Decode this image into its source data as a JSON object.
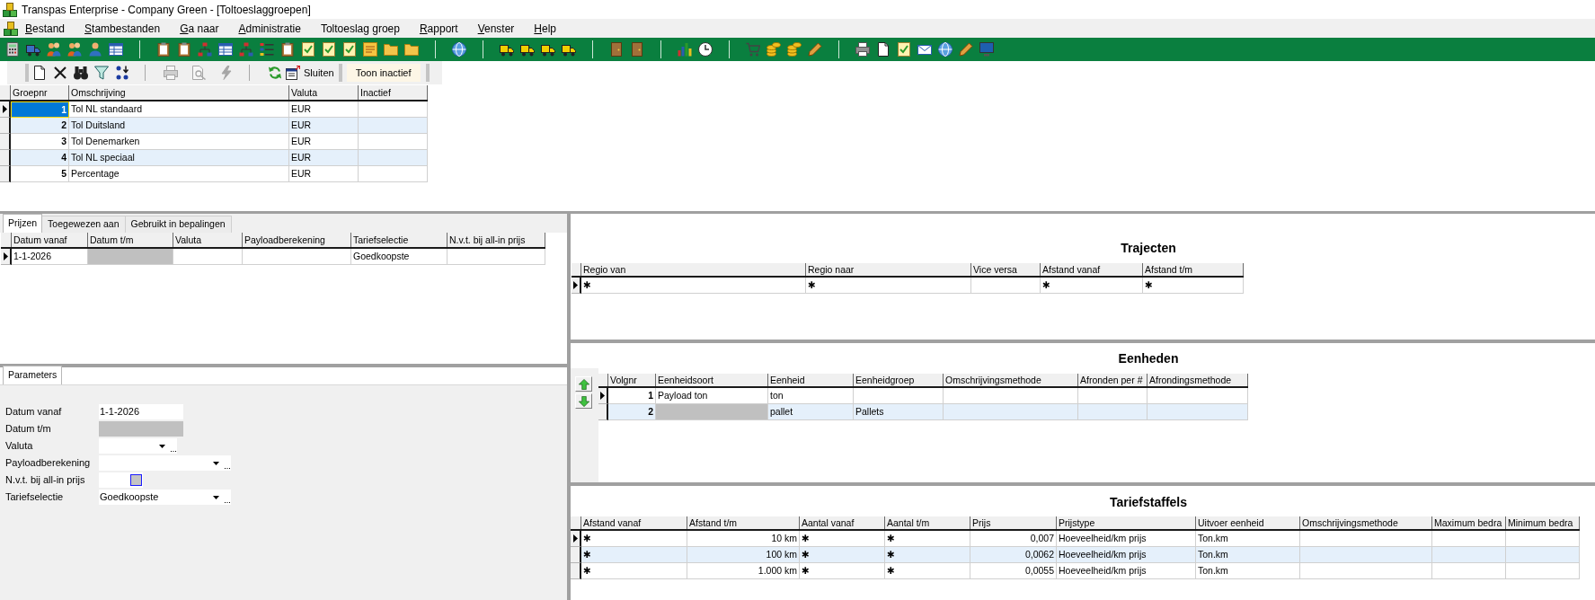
{
  "window": {
    "title": "Transpas Enterprise - Company Green - [Toltoeslaggroepen]"
  },
  "menu": [
    {
      "label": "Bestand",
      "mnemonic": true
    },
    {
      "label": "Stambestanden",
      "mnemonic": true
    },
    {
      "label": "Ga naar",
      "mnemonic": true
    },
    {
      "label": "Administratie",
      "mnemonic": true
    },
    {
      "label": "Toltoeslag groep",
      "mnemonic": false
    },
    {
      "label": "Rapport",
      "mnemonic": true
    },
    {
      "label": "Venster",
      "mnemonic": true
    },
    {
      "label": "Help",
      "mnemonic": true
    }
  ],
  "record_toolbar": {
    "tools": [
      {
        "disabled": false
      },
      {
        "disabled": false
      },
      {
        "disabled": false
      },
      {
        "disabled": false
      },
      {
        "disabled": false
      },
      {
        "disabled": true
      },
      {
        "disabled": true
      },
      {
        "disabled": true
      },
      {
        "disabled": false
      }
    ],
    "close_label": "Sluiten",
    "toggle_label": "Toon inactief"
  },
  "groups_table": {
    "columns": [
      "Groepnr",
      "Omschrijving",
      "Valuta",
      "Inactief"
    ],
    "rows": [
      {
        "selected": true,
        "cells": [
          {
            "text": "1",
            "focused": true
          },
          {
            "text": "Tol NL standaard",
            "focused": false
          },
          {
            "text": "EUR",
            "focused": false
          },
          {
            "focused": false
          }
        ]
      },
      {
        "selected": false,
        "cells": [
          {
            "text": "2",
            "focused": false
          },
          {
            "text": "Tol Duitsland",
            "focused": false
          },
          {
            "text": "EUR",
            "focused": false
          },
          {
            "focused": false
          }
        ]
      },
      {
        "selected": false,
        "cells": [
          {
            "text": "3",
            "focused": false
          },
          {
            "text": "Tol Denemarken",
            "focused": false
          },
          {
            "text": "EUR",
            "focused": false
          },
          {
            "focused": false
          }
        ]
      },
      {
        "selected": false,
        "cells": [
          {
            "text": "4",
            "focused": false
          },
          {
            "text": "Tol NL speciaal",
            "focused": false
          },
          {
            "text": "EUR",
            "focused": false
          },
          {
            "focused": false
          }
        ]
      },
      {
        "selected": false,
        "cells": [
          {
            "text": "5",
            "focused": false
          },
          {
            "text": "Percentage",
            "focused": false
          },
          {
            "text": "EUR",
            "focused": false
          },
          {
            "focused": false
          }
        ]
      }
    ]
  },
  "price_tabs": [
    {
      "label": "Prijzen",
      "selected": true
    },
    {
      "label": "Toegewezen aan",
      "selected": false
    },
    {
      "label": "Gebruikt in bepalingen",
      "selected": false
    }
  ],
  "prices_table": {
    "columns": [
      "Datum vanaf",
      "Datum t/m",
      "Valuta",
      "Payloadberekening",
      "Tariefselectie",
      "N.v.t. bij all-in prijs"
    ],
    "rows": [
      {
        "selected": true,
        "cells": [
          {
            "text": "1-1-2026",
            "disabled": false
          },
          {
            "disabled": true
          },
          {
            "disabled": false
          },
          {
            "disabled": false
          },
          {
            "text": "Goedkoopste",
            "disabled": false
          },
          {
            "disabled": false
          }
        ]
      }
    ]
  },
  "parameter_tabs": [
    {
      "label": "Parameters",
      "selected": true
    }
  ],
  "parameters": [
    {
      "kind": "text",
      "label": "Datum vanaf",
      "value": "1-1-2026",
      "disabled": false
    },
    {
      "kind": "text",
      "label": "Datum t/m",
      "disabled": true
    },
    {
      "kind": "dropdown",
      "label": "Valuta",
      "disabled": false
    },
    {
      "kind": "dropdown",
      "label": "Payloadberekening",
      "disabled": false
    },
    {
      "kind": "checkbox",
      "label": "N.v.t. bij all-in prijs",
      "checked": false,
      "disabled": false
    },
    {
      "kind": "dropdown",
      "label": "Tariefselectie",
      "value": "Goedkoopste",
      "disabled": false
    }
  ],
  "routes": {
    "title": "Trajecten",
    "columns": [
      "Regio van",
      "Regio naar",
      "Vice versa",
      "Afstand vanaf",
      "Afstand t/m"
    ],
    "rows": [
      {
        "selected": true,
        "cells": [
          {
            "text": "✱",
            "disabled": false
          },
          {
            "text": "✱",
            "disabled": false
          },
          {
            "disabled": false
          },
          {
            "text": "✱",
            "disabled": false
          },
          {
            "text": "✱",
            "disabled": false
          }
        ]
      }
    ]
  },
  "units": {
    "title": "Eenheden",
    "columns": [
      "Volgnr",
      "Eenheidsoort",
      "Eenheid",
      "Eenheidgroep",
      "Omschrijvingsmethode",
      "Afronden per #",
      "Afrondingsmethode"
    ],
    "rows": [
      {
        "selected": true,
        "cells": [
          {
            "text": "1",
            "disabled": false
          },
          {
            "text": "Payload ton",
            "disabled": false
          },
          {
            "text": "ton",
            "disabled": false
          },
          {
            "disabled": false
          },
          {
            "disabled": false
          },
          {
            "disabled": false
          },
          {
            "disabled": false
          }
        ]
      },
      {
        "selected": false,
        "cells": [
          {
            "text": "2",
            "disabled": false
          },
          {
            "disabled": true
          },
          {
            "text": "pallet",
            "disabled": false
          },
          {
            "text": "Pallets",
            "disabled": false
          },
          {
            "disabled": false
          },
          {
            "disabled": false
          },
          {
            "disabled": false
          }
        ]
      }
    ]
  },
  "rate_scales": {
    "title": "Tariefstaffels",
    "columns": [
      "Afstand vanaf",
      "Afstand t/m",
      "Aantal vanaf",
      "Aantal t/m",
      "Prijs",
      "Prijstype",
      "Uitvoer eenheid",
      "Omschrijvingsmethode",
      "Maximum bedra",
      "Minimum bedra"
    ],
    "rows": [
      {
        "selected": true,
        "cells": [
          {
            "text": "✱",
            "disabled": false
          },
          {
            "text": "10 km",
            "disabled": false
          },
          {
            "text": "✱",
            "disabled": false
          },
          {
            "text": "✱",
            "disabled": false
          },
          {
            "text": "0,007",
            "disabled": false
          },
          {
            "text": "Hoeveelheid/km prijs",
            "disabled": false
          },
          {
            "text": "Ton.km",
            "disabled": false
          },
          {
            "disabled": false
          },
          {
            "disabled": false
          },
          {
            "disabled": false
          }
        ]
      },
      {
        "selected": false,
        "cells": [
          {
            "text": "✱",
            "disabled": false
          },
          {
            "text": "100 km",
            "disabled": false
          },
          {
            "text": "✱",
            "disabled": false
          },
          {
            "text": "✱",
            "disabled": false
          },
          {
            "text": "0,0062",
            "disabled": false
          },
          {
            "text": "Hoeveelheid/km prijs",
            "disabled": false
          },
          {
            "text": "Ton.km",
            "disabled": false
          },
          {
            "disabled": false
          },
          {
            "disabled": false
          },
          {
            "disabled": false
          }
        ]
      },
      {
        "selected": false,
        "cells": [
          {
            "text": "✱",
            "disabled": false
          },
          {
            "text": "1.000 km",
            "disabled": false
          },
          {
            "text": "✱",
            "disabled": false
          },
          {
            "text": "✱",
            "disabled": false
          },
          {
            "text": "0,0055",
            "disabled": false
          },
          {
            "text": "Hoeveelheid/km prijs",
            "disabled": false
          },
          {
            "text": "Ton.km",
            "disabled": false
          },
          {
            "disabled": false
          },
          {
            "disabled": false
          },
          {
            "disabled": false
          }
        ]
      }
    ]
  }
}
